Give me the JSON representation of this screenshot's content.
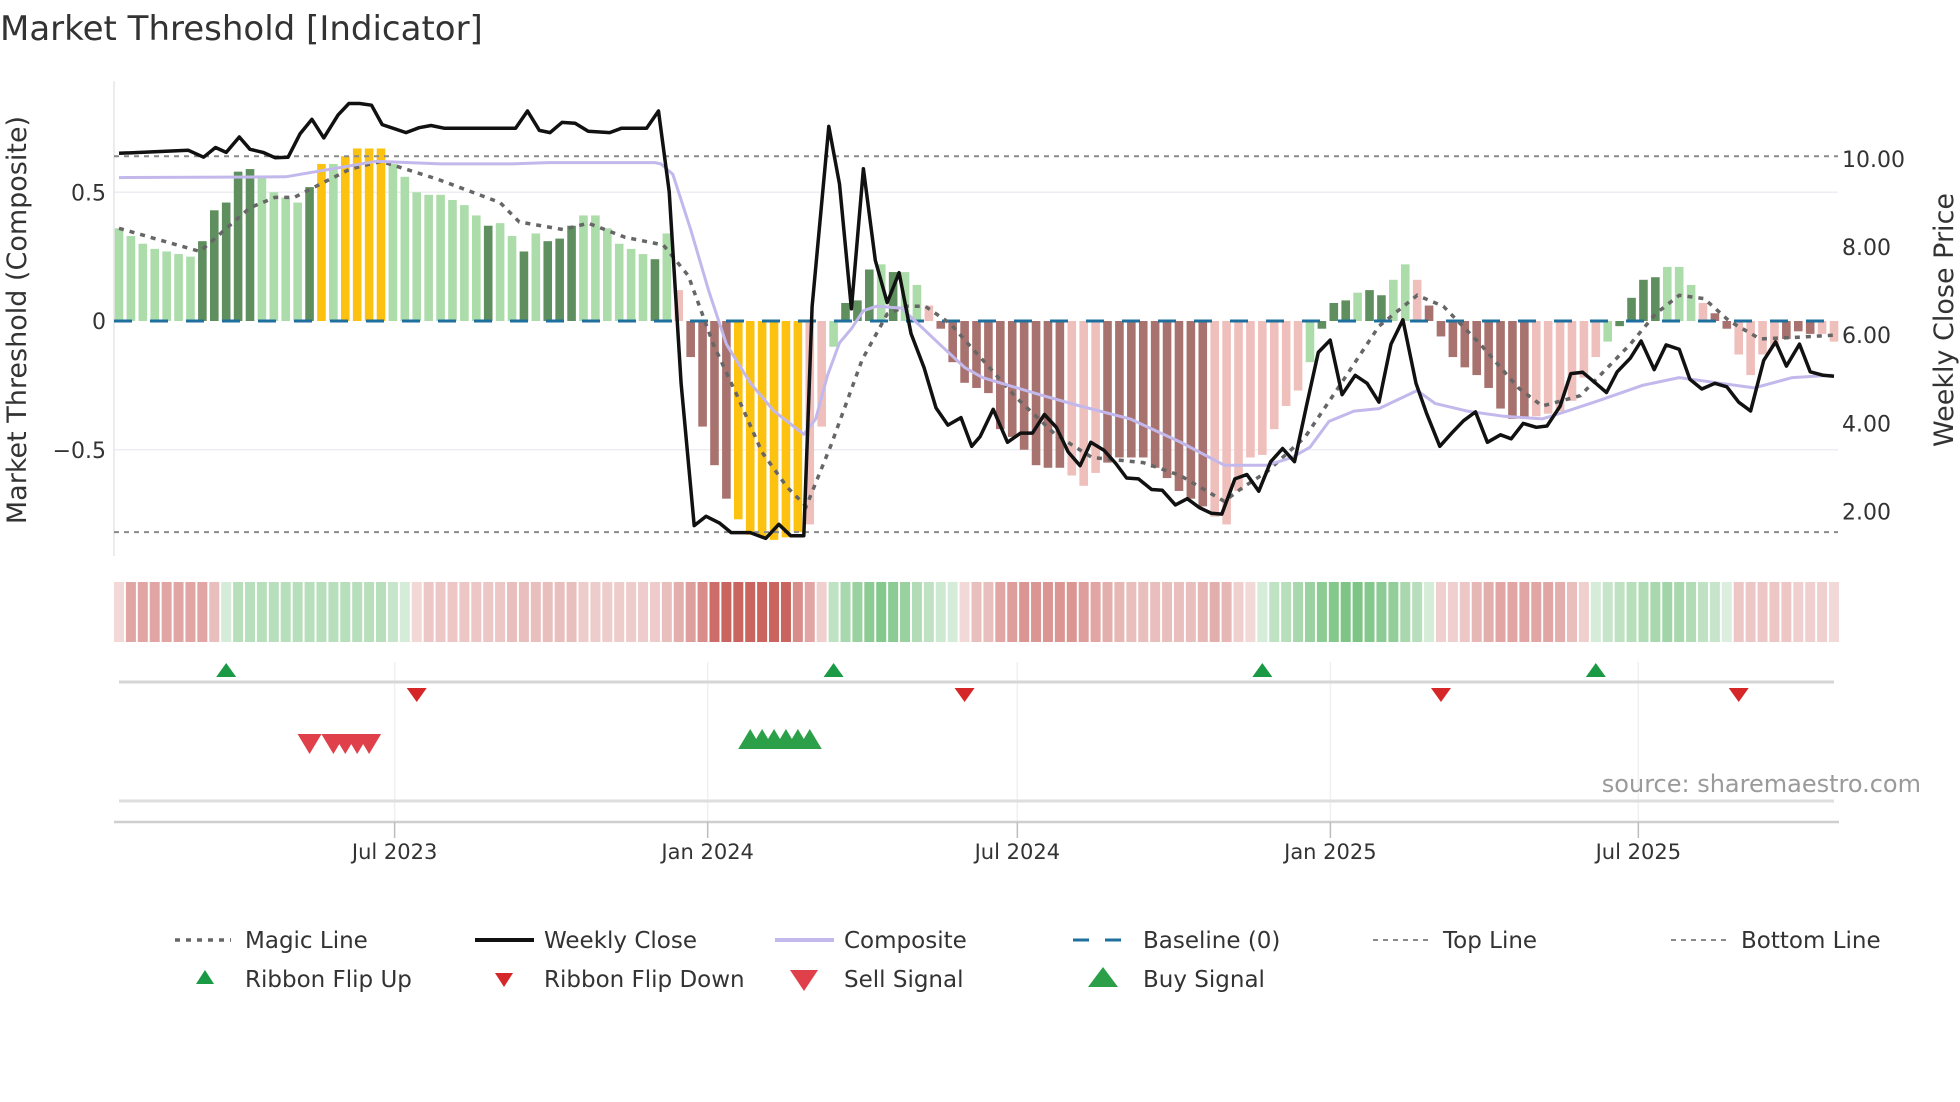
{
  "title": "Market Threshold [Indicator]",
  "source": "source: sharemaestro.com",
  "colors": {
    "bar_G": "#5f8f5f",
    "bar_g": "#acdcaa",
    "bar_Y": "#fdc20f",
    "bar_R": "#a8726e",
    "bar_r": "#efbfbc",
    "ribbon_bull": "#64b96e",
    "ribbon_bear": "#c3504b",
    "weekly_close": "#111111",
    "composite": "#c3b8ec",
    "magic": "#666666",
    "baseline": "#1f6f9e",
    "threshold": "#8a8a8a",
    "flip_up": "#1a9a44",
    "flip_down": "#d62728",
    "sell": "#e0404a",
    "buy": "#2ca048"
  },
  "legend": {
    "magic": "Magic Line",
    "close": "Weekly Close",
    "composite": "Composite",
    "baseline": "Baseline (0)",
    "top": "Top Line",
    "bottom": "Bottom Line",
    "flip_up": "Ribbon Flip Up",
    "flip_down": "Ribbon Flip Down",
    "sell": "Sell Signal",
    "buy": "Buy Signal"
  },
  "chart_data": {
    "type": "bar+line",
    "title": "Market Threshold [Indicator]",
    "ylabel_left": "Market Threshold (Composite)",
    "ylabel_right": "Weekly Close Price",
    "x_start": "2023-01-20",
    "x_interval_days": 7,
    "ylim_left": [
      -0.91,
      0.93
    ],
    "ylim_right": [
      0.98,
      11.76
    ],
    "left_ticks": [
      {
        "value": 0.5,
        "label": "0.5"
      },
      {
        "value": 0,
        "label": "0"
      },
      {
        "value": -0.5,
        "label": "−0.5"
      }
    ],
    "right_ticks": [
      {
        "value": 10,
        "label": "10.00"
      },
      {
        "value": 8,
        "label": "8.00"
      },
      {
        "value": 6,
        "label": "6.00"
      },
      {
        "value": 4,
        "label": "4.00"
      },
      {
        "value": 2,
        "label": "2.00"
      }
    ],
    "x_ticks": [
      {
        "date": "2023-07-01",
        "label": "Jul 2023"
      },
      {
        "date": "2024-01-01",
        "label": "Jan 2024"
      },
      {
        "date": "2024-07-01",
        "label": "Jul 2024"
      },
      {
        "date": "2025-01-01",
        "label": "Jan 2025"
      },
      {
        "date": "2025-07-01",
        "label": "Jul 2025"
      }
    ],
    "top_line": 0.64,
    "bottom_line": -0.82,
    "baseline": 0,
    "composite_bars": [
      0.36,
      0.33,
      0.3,
      0.28,
      0.27,
      0.26,
      0.25,
      0.31,
      0.43,
      0.46,
      0.58,
      0.59,
      0.56,
      0.5,
      0.48,
      0.46,
      0.52,
      0.61,
      0.61,
      0.64,
      0.67,
      0.67,
      0.67,
      0.61,
      0.56,
      0.5,
      0.49,
      0.49,
      0.47,
      0.45,
      0.41,
      0.37,
      0.38,
      0.33,
      0.27,
      0.34,
      0.31,
      0.32,
      0.37,
      0.41,
      0.41,
      0.36,
      0.3,
      0.28,
      0.26,
      0.24,
      0.34,
      0.12,
      -0.14,
      -0.41,
      -0.56,
      -0.69,
      -0.77,
      -0.83,
      -0.84,
      -0.85,
      -0.84,
      -0.82,
      -0.79,
      -0.41,
      -0.1,
      0.07,
      0.08,
      0.2,
      0.22,
      0.19,
      0.19,
      0.14,
      0.06,
      -0.03,
      -0.16,
      -0.24,
      -0.26,
      -0.28,
      -0.42,
      -0.45,
      -0.5,
      -0.56,
      -0.57,
      -0.57,
      -0.6,
      -0.64,
      -0.59,
      -0.55,
      -0.53,
      -0.53,
      -0.53,
      -0.57,
      -0.61,
      -0.66,
      -0.69,
      -0.72,
      -0.76,
      -0.79,
      -0.66,
      -0.53,
      -0.52,
      -0.42,
      -0.33,
      -0.27,
      -0.16,
      -0.03,
      0.07,
      0.08,
      0.11,
      0.12,
      0.1,
      0.16,
      0.22,
      0.16,
      0.06,
      -0.06,
      -0.14,
      -0.18,
      -0.21,
      -0.26,
      -0.34,
      -0.38,
      -0.38,
      -0.37,
      -0.36,
      -0.35,
      -0.31,
      -0.22,
      -0.14,
      -0.08,
      -0.02,
      0.09,
      0.16,
      0.17,
      0.21,
      0.21,
      0.14,
      0.07,
      0.03,
      -0.03,
      -0.13,
      -0.21,
      -0.13,
      -0.1,
      -0.07,
      -0.04,
      -0.05,
      -0.05,
      -0.08
    ],
    "bar_states": "gggggggGGGGGggggGYgYYYYggggggggGggGgGGGggggggGgrRRRRYYYYYYrrgGGGgGggrRRRRRRRRRRRrrrRRRRRRRRRrrrrrrrrgGGGgGGggrRRRRRRRRRrrrrrrgGGGGgggrRRrrrrRRR",
    "bar_state_legend": {
      "G": "positive rising",
      "g": "positive falling",
      "Y": "extreme",
      "R": "negative falling",
      "r": "negative rising"
    },
    "ribbon": [
      -0.15,
      -0.45,
      -0.45,
      -0.45,
      -0.45,
      -0.45,
      -0.45,
      -0.45,
      -0.3,
      0.2,
      0.4,
      0.4,
      0.4,
      0.4,
      0.4,
      0.4,
      0.4,
      0.4,
      0.4,
      0.4,
      0.4,
      0.4,
      0.4,
      0.3,
      0.2,
      -0.15,
      -0.25,
      -0.25,
      -0.25,
      -0.25,
      -0.25,
      -0.25,
      -0.25,
      -0.3,
      -0.3,
      -0.3,
      -0.3,
      -0.3,
      -0.3,
      -0.22,
      -0.22,
      -0.22,
      -0.22,
      -0.22,
      -0.22,
      -0.22,
      -0.3,
      -0.4,
      -0.5,
      -0.6,
      -0.8,
      -0.85,
      -0.85,
      -0.85,
      -0.85,
      -0.85,
      -0.85,
      -0.6,
      -0.45,
      -0.2,
      0.35,
      0.5,
      0.6,
      0.7,
      0.75,
      0.7,
      0.6,
      0.45,
      0.35,
      0.25,
      0.2,
      -0.15,
      -0.3,
      -0.3,
      -0.45,
      -0.5,
      -0.55,
      -0.55,
      -0.55,
      -0.55,
      -0.55,
      -0.5,
      -0.45,
      -0.4,
      -0.35,
      -0.3,
      -0.3,
      -0.3,
      -0.3,
      -0.3,
      -0.3,
      -0.35,
      -0.4,
      -0.35,
      -0.2,
      -0.15,
      0.2,
      0.35,
      0.4,
      0.5,
      0.6,
      0.7,
      0.75,
      0.8,
      0.8,
      0.75,
      0.7,
      0.65,
      0.5,
      0.4,
      0.2,
      -0.2,
      -0.2,
      -0.25,
      -0.35,
      -0.4,
      -0.45,
      -0.45,
      -0.45,
      -0.45,
      -0.45,
      -0.4,
      -0.3,
      -0.2,
      0.2,
      0.3,
      0.35,
      0.4,
      0.45,
      0.5,
      0.55,
      0.5,
      0.45,
      0.35,
      0.3,
      0.15,
      -0.25,
      -0.25,
      -0.25,
      -0.25,
      -0.25,
      -0.2,
      -0.2,
      -0.2,
      -0.15
    ],
    "ribbon_flip_up_weeks": [
      9,
      60,
      96,
      124
    ],
    "ribbon_flip_down_weeks": [
      25,
      71,
      111,
      136
    ],
    "sell_signal_weeks": [
      16,
      18,
      19,
      20,
      21
    ],
    "buy_signal_weeks": [
      53,
      54,
      55,
      56,
      57,
      58
    ],
    "composite_line": [
      [
        0,
        0.557
      ],
      [
        14,
        0.56
      ],
      [
        21.6,
        0.62
      ],
      [
        27,
        0.61
      ],
      [
        33,
        0.61
      ],
      [
        36,
        0.615
      ],
      [
        45,
        0.615
      ],
      [
        45.5,
        0.61
      ],
      [
        46.5,
        0.57
      ],
      [
        48,
        0.355
      ],
      [
        49.5,
        0.12
      ],
      [
        51,
        -0.09
      ],
      [
        53,
        -0.24
      ],
      [
        55,
        -0.35
      ],
      [
        57.5,
        -0.44
      ],
      [
        58.5,
        -0.38
      ],
      [
        59.5,
        -0.21
      ],
      [
        60.5,
        -0.085
      ],
      [
        61.5,
        -0.03
      ],
      [
        62.5,
        0.04
      ],
      [
        63.6,
        0.057
      ],
      [
        65.7,
        0.05
      ],
      [
        67.3,
        -0.02
      ],
      [
        68.9,
        -0.09
      ],
      [
        71,
        -0.18
      ],
      [
        72.5,
        -0.22
      ],
      [
        77.6,
        -0.29
      ],
      [
        80.7,
        -0.33
      ],
      [
        84.9,
        -0.38
      ],
      [
        89.1,
        -0.47
      ],
      [
        92.8,
        -0.56
      ],
      [
        96.4,
        -0.56
      ],
      [
        98.5,
        -0.53
      ],
      [
        100,
        -0.49
      ],
      [
        101.6,
        -0.39
      ],
      [
        103.7,
        -0.35
      ],
      [
        105.8,
        -0.34
      ],
      [
        109,
        -0.27
      ],
      [
        110.5,
        -0.32
      ],
      [
        113.2,
        -0.35
      ],
      [
        116.3,
        -0.37
      ],
      [
        119.5,
        -0.38
      ],
      [
        121.6,
        -0.35
      ],
      [
        124.2,
        -0.31
      ],
      [
        127.9,
        -0.25
      ],
      [
        131,
        -0.22
      ],
      [
        134.2,
        -0.24
      ],
      [
        137.3,
        -0.26
      ],
      [
        140.5,
        -0.22
      ],
      [
        143.9,
        -0.21
      ]
    ],
    "magic_line": [
      [
        0,
        0.36
      ],
      [
        6.8,
        0.27
      ],
      [
        11,
        0.44
      ],
      [
        13.1,
        0.48
      ],
      [
        14.7,
        0.48
      ],
      [
        19.4,
        0.59
      ],
      [
        22,
        0.62
      ],
      [
        26.8,
        0.55
      ],
      [
        32,
        0.46
      ],
      [
        33.6,
        0.385
      ],
      [
        37.3,
        0.355
      ],
      [
        39.4,
        0.38
      ],
      [
        42.5,
        0.325
      ],
      [
        45.7,
        0.295
      ],
      [
        47.8,
        0.176
      ],
      [
        49.9,
        -0.09
      ],
      [
        52,
        -0.3
      ],
      [
        54,
        -0.51
      ],
      [
        56.1,
        -0.645
      ],
      [
        57.7,
        -0.72
      ],
      [
        59.8,
        -0.48
      ],
      [
        62.4,
        -0.15
      ],
      [
        64.5,
        0.027
      ],
      [
        66.1,
        0.057
      ],
      [
        67.7,
        0.057
      ],
      [
        69.8,
        -0.01
      ],
      [
        71.9,
        -0.12
      ],
      [
        72.3,
        -0.14
      ],
      [
        75.4,
        -0.3
      ],
      [
        78.6,
        -0.44
      ],
      [
        81.7,
        -0.53
      ],
      [
        86,
        -0.55
      ],
      [
        89.1,
        -0.6
      ],
      [
        92.8,
        -0.7
      ],
      [
        94.4,
        -0.645
      ],
      [
        96.4,
        -0.585
      ],
      [
        99.6,
        -0.45
      ],
      [
        102.8,
        -0.23
      ],
      [
        105.8,
        -0.02
      ],
      [
        109,
        0.1
      ],
      [
        111.2,
        0.057
      ],
      [
        114.3,
        -0.09
      ],
      [
        117.5,
        -0.26
      ],
      [
        119.5,
        -0.33
      ],
      [
        122.7,
        -0.29
      ],
      [
        126.9,
        -0.09
      ],
      [
        129,
        0.027
      ],
      [
        131,
        0.1
      ],
      [
        133.1,
        0.087
      ],
      [
        135.2,
        0
      ],
      [
        137.8,
        -0.07
      ],
      [
        141,
        -0.063
      ],
      [
        143.9,
        -0.055
      ]
    ],
    "weekly_close": [
      [
        0,
        10.13
      ],
      [
        5.8,
        10.2
      ],
      [
        7.1,
        10.04
      ],
      [
        8.1,
        10.26
      ],
      [
        9,
        10.15
      ],
      [
        10.1,
        10.5
      ],
      [
        11,
        10.22
      ],
      [
        12.1,
        10.15
      ],
      [
        13.1,
        10.03
      ],
      [
        14.2,
        10.04
      ],
      [
        15.2,
        10.57
      ],
      [
        16.2,
        10.9
      ],
      [
        17.2,
        10.48
      ],
      [
        18.4,
        11.0
      ],
      [
        19.3,
        11.26
      ],
      [
        20.2,
        11.26
      ],
      [
        21.2,
        11.22
      ],
      [
        22.1,
        10.78
      ],
      [
        24.1,
        10.6
      ],
      [
        25.2,
        10.71
      ],
      [
        26.2,
        10.76
      ],
      [
        27.3,
        10.7
      ],
      [
        33.3,
        10.7
      ],
      [
        34.3,
        11.09
      ],
      [
        35.3,
        10.65
      ],
      [
        36.2,
        10.6
      ],
      [
        37.2,
        10.83
      ],
      [
        38.3,
        10.81
      ],
      [
        39.4,
        10.63
      ],
      [
        41.2,
        10.6
      ],
      [
        42.2,
        10.7
      ],
      [
        44.3,
        10.7
      ],
      [
        45.3,
        11.09
      ],
      [
        46.2,
        9.26
      ],
      [
        47.2,
        4.91
      ],
      [
        48.3,
        1.68
      ],
      [
        49.3,
        1.89
      ],
      [
        50.4,
        1.74
      ],
      [
        51.4,
        1.52
      ],
      [
        53,
        1.52
      ],
      [
        54.3,
        1.39
      ],
      [
        55.4,
        1.71
      ],
      [
        56.4,
        1.45
      ],
      [
        57.5,
        1.45
      ],
      [
        58.2,
        6.65
      ],
      [
        59.6,
        10.74
      ],
      [
        60.5,
        9.43
      ],
      [
        61.5,
        6.6
      ],
      [
        62.5,
        9.78
      ],
      [
        63.5,
        7.7
      ],
      [
        64.5,
        6.74
      ],
      [
        65.5,
        7.42
      ],
      [
        66.5,
        6.04
      ],
      [
        67.6,
        5.26
      ],
      [
        68.6,
        4.35
      ],
      [
        69.6,
        3.96
      ],
      [
        70.7,
        4.13
      ],
      [
        71.6,
        3.48
      ],
      [
        72.3,
        3.7
      ],
      [
        73.4,
        4.32
      ],
      [
        74.6,
        3.57
      ],
      [
        75.7,
        3.78
      ],
      [
        76.7,
        3.78
      ],
      [
        77.7,
        4.2
      ],
      [
        78.7,
        3.91
      ],
      [
        79.7,
        3.35
      ],
      [
        80.7,
        3.04
      ],
      [
        81.6,
        3.57
      ],
      [
        82.7,
        3.39
      ],
      [
        83.7,
        3.09
      ],
      [
        84.6,
        2.76
      ],
      [
        85.6,
        2.74
      ],
      [
        86.7,
        2.5
      ],
      [
        87.6,
        2.48
      ],
      [
        88.7,
        2.15
      ],
      [
        89.7,
        2.29
      ],
      [
        90.7,
        2.09
      ],
      [
        91.7,
        1.96
      ],
      [
        92.6,
        1.94
      ],
      [
        93.7,
        2.74
      ],
      [
        94.7,
        2.84
      ],
      [
        95.7,
        2.46
      ],
      [
        96.7,
        3.13
      ],
      [
        97.7,
        3.43
      ],
      [
        98.7,
        3.13
      ],
      [
        99.7,
        4.39
      ],
      [
        100.7,
        5.61
      ],
      [
        101.7,
        5.89
      ],
      [
        102.7,
        4.65
      ],
      [
        103.8,
        5.09
      ],
      [
        104.8,
        4.91
      ],
      [
        105.8,
        4.48
      ],
      [
        106.8,
        5.8
      ],
      [
        107.8,
        6.35
      ],
      [
        108.9,
        4.91
      ],
      [
        109.8,
        4.22
      ],
      [
        110.9,
        3.48
      ],
      [
        111.9,
        3.78
      ],
      [
        112.9,
        4.06
      ],
      [
        113.9,
        4.26
      ],
      [
        114.9,
        3.57
      ],
      [
        116,
        3.74
      ],
      [
        116.9,
        3.65
      ],
      [
        117.9,
        4.0
      ],
      [
        119,
        3.91
      ],
      [
        119.9,
        3.94
      ],
      [
        121,
        4.39
      ],
      [
        121.9,
        5.13
      ],
      [
        122.9,
        5.16
      ],
      [
        124,
        4.91
      ],
      [
        124.9,
        4.7
      ],
      [
        125.8,
        5.17
      ],
      [
        126.9,
        5.48
      ],
      [
        127.8,
        5.87
      ],
      [
        128.9,
        5.22
      ],
      [
        129.9,
        5.78
      ],
      [
        131,
        5.68
      ],
      [
        131.9,
        5.0
      ],
      [
        132.9,
        4.78
      ],
      [
        134,
        4.91
      ],
      [
        135,
        4.83
      ],
      [
        136,
        4.48
      ],
      [
        137,
        4.28
      ],
      [
        138.1,
        5.43
      ],
      [
        139.1,
        5.85
      ],
      [
        140,
        5.3
      ],
      [
        141.1,
        5.8
      ],
      [
        142,
        5.17
      ],
      [
        143.1,
        5.09
      ],
      [
        144,
        5.07
      ]
    ],
    "grid": true,
    "legend_position": "bottom"
  }
}
